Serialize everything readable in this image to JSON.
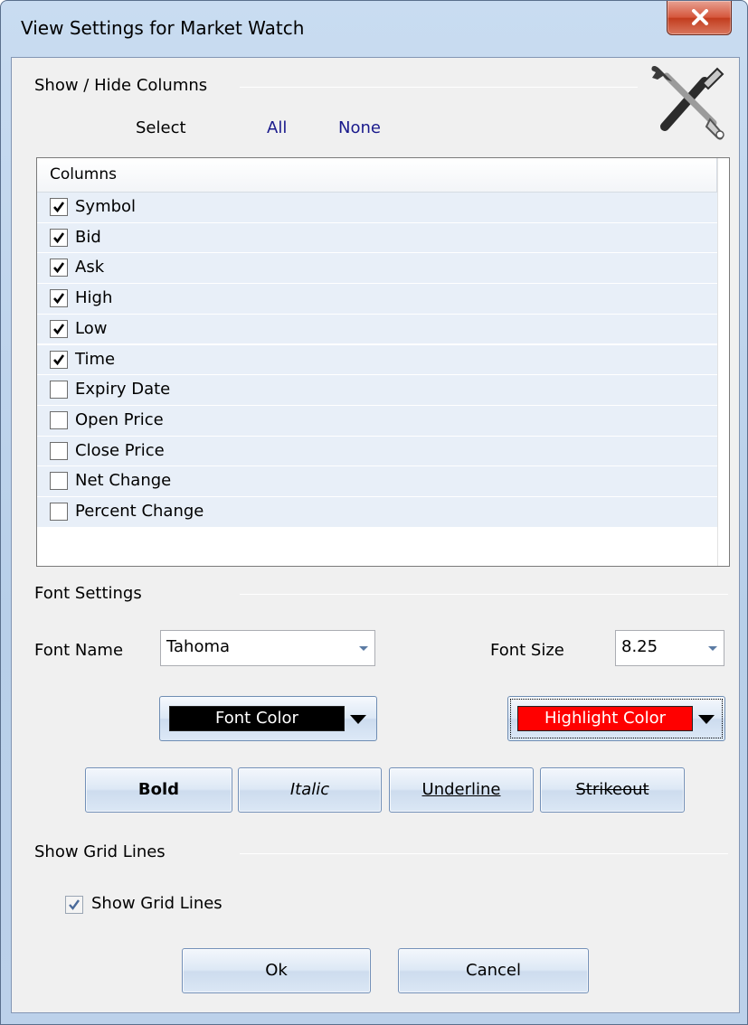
{
  "window": {
    "title": "View Settings for Market Watch",
    "close_glyph": "X"
  },
  "columns_section": {
    "heading": "Show / Hide Columns",
    "select_label": "Select",
    "all_link": "All",
    "none_link": "None",
    "icon": "tools-icon",
    "list_header": "Columns",
    "items": [
      {
        "label": "Symbol",
        "checked": true
      },
      {
        "label": "Bid",
        "checked": true
      },
      {
        "label": "Ask",
        "checked": true
      },
      {
        "label": "High",
        "checked": true
      },
      {
        "label": "Low",
        "checked": true
      },
      {
        "label": "Time",
        "checked": true
      },
      {
        "label": "Expiry Date",
        "checked": false
      },
      {
        "label": "Open Price",
        "checked": false
      },
      {
        "label": "Close Price",
        "checked": false
      },
      {
        "label": "Net Change",
        "checked": false
      },
      {
        "label": "Percent Change",
        "checked": false
      }
    ]
  },
  "font_section": {
    "heading": "Font Settings",
    "font_name_label": "Font Name",
    "font_name_value": "Tahoma",
    "font_size_label": "Font Size",
    "font_size_value": "8.25",
    "font_color_label": "Font Color",
    "font_color": "#000000",
    "highlight_color_label": "Highlight Color",
    "highlight_color": "#ff0000",
    "bold_label": "Bold",
    "italic_label": "Italic",
    "underline_label": "Underline",
    "strikeout_label": "Strikeout"
  },
  "grid_section": {
    "heading": "Show Grid Lines",
    "checkbox_label": "Show Grid Lines",
    "checked": true
  },
  "footer": {
    "ok_label": "Ok",
    "cancel_label": "Cancel"
  }
}
